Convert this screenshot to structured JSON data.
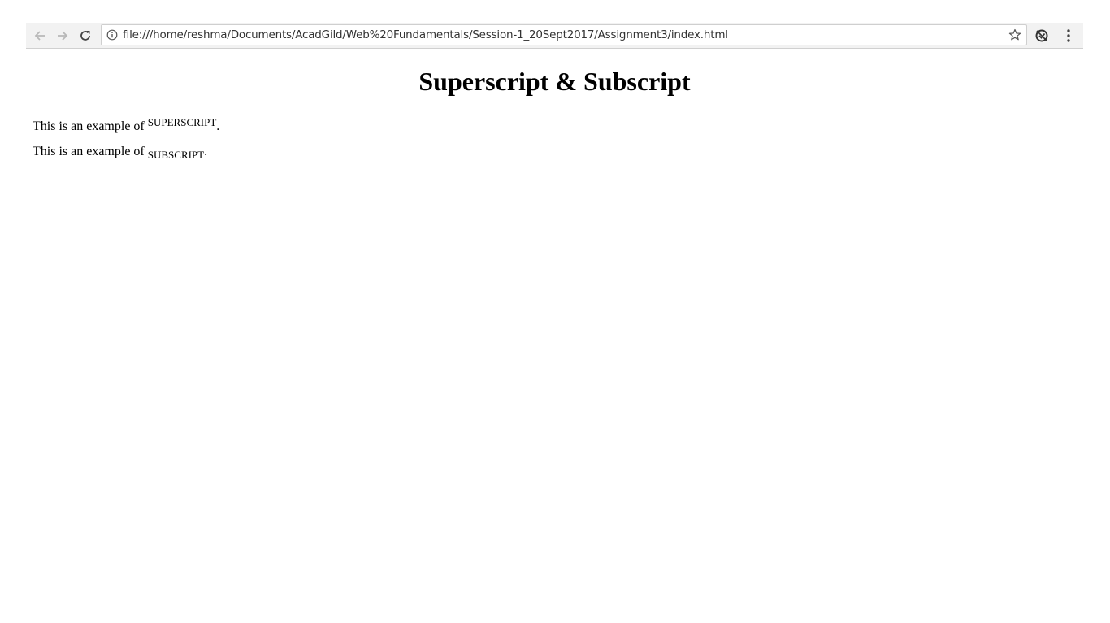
{
  "browser": {
    "url": "file:///home/reshma/Documents/AcadGild/Web%20Fundamentals/Session-1_20Sept2017/Assignment3/index.html",
    "icons": {
      "back": "arrow-left-icon",
      "forward": "arrow-right-icon",
      "reload": "reload-icon",
      "info": "info-icon",
      "bookmark": "star-icon",
      "extension": "sync-extension-icon",
      "menu": "vertical-dots-menu-icon"
    }
  },
  "page": {
    "heading": "Superscript & Subscript",
    "paragraphs": [
      {
        "prefix": "This is an example of ",
        "script_text": "SUPERSCRIPT",
        "suffix": "."
      },
      {
        "prefix": "This is an example of ",
        "script_text": "SUBSCRIPT",
        "suffix": "."
      }
    ]
  }
}
